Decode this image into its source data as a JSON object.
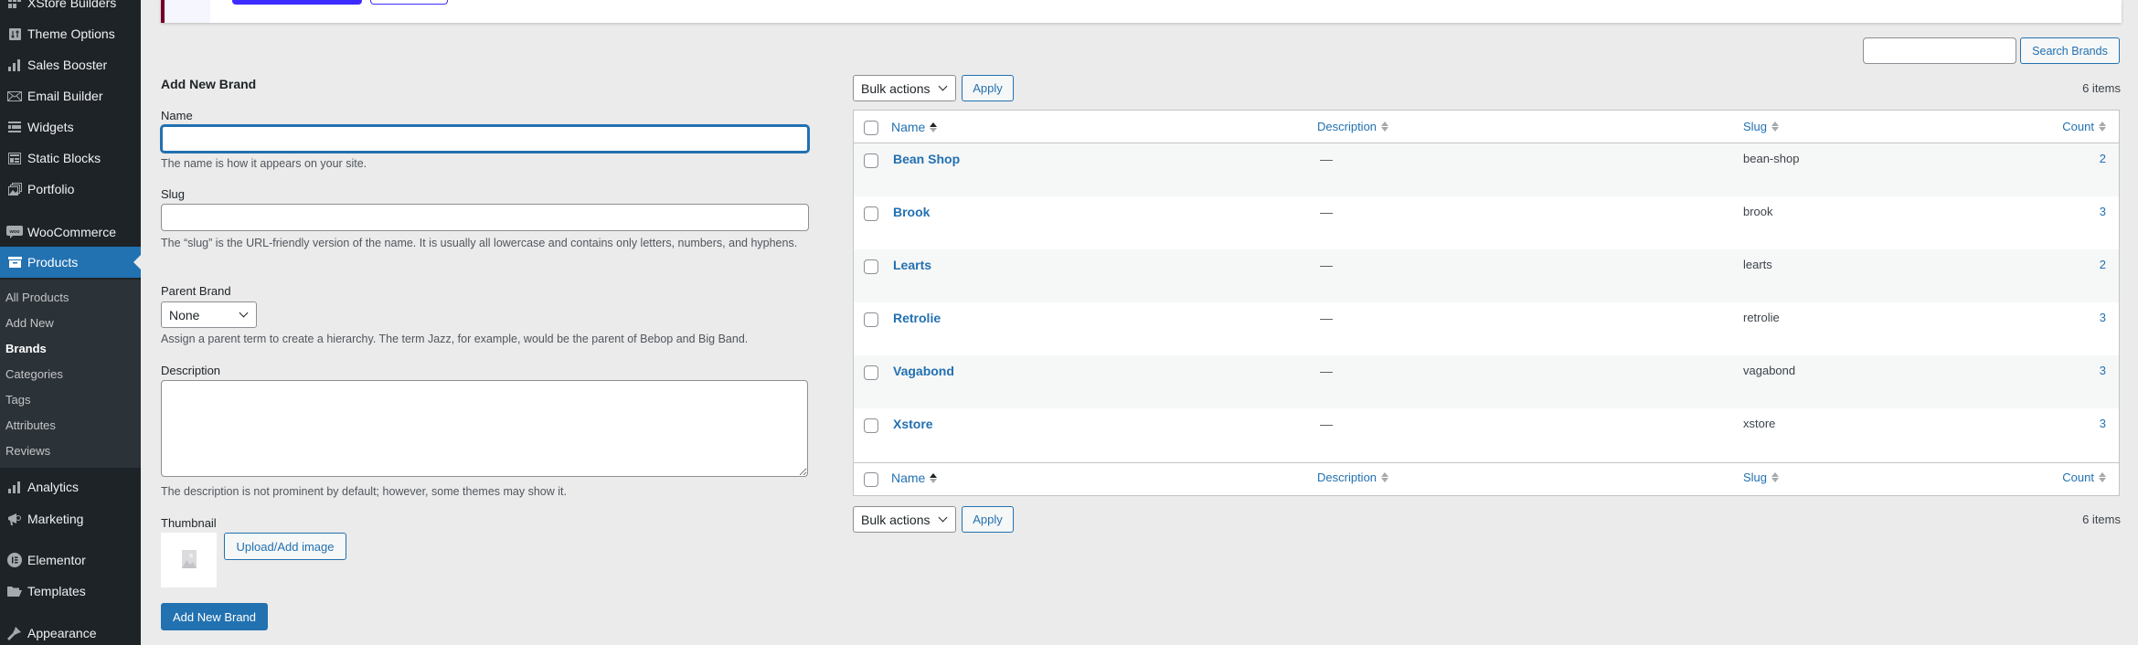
{
  "sidebar": {
    "items": [
      {
        "label": "XStore Builders",
        "icon": "grid-icon"
      },
      {
        "label": "Theme Options",
        "icon": "settings-icon"
      },
      {
        "label": "Sales Booster",
        "icon": "bar-chart-icon"
      },
      {
        "label": "Email Builder",
        "icon": "envelope-icon"
      },
      {
        "label": "Widgets",
        "icon": "widgets-icon"
      },
      {
        "label": "Static Blocks",
        "icon": "blocks-icon"
      },
      {
        "label": "Portfolio",
        "icon": "portfolio-icon"
      },
      {
        "label": "WooCommerce",
        "icon": "woo-icon"
      },
      {
        "label": "Products",
        "icon": "archive-icon"
      },
      {
        "label": "Analytics",
        "icon": "bar-chart-icon"
      },
      {
        "label": "Marketing",
        "icon": "megaphone-icon"
      },
      {
        "label": "Elementor",
        "icon": "elementor-icon"
      },
      {
        "label": "Templates",
        "icon": "folder-icon"
      },
      {
        "label": "Appearance",
        "icon": "brush-icon"
      }
    ],
    "submenu": [
      "All Products",
      "Add New",
      "Brands",
      "Categories",
      "Tags",
      "Attributes",
      "Reviews"
    ],
    "current_submenu": "Brands"
  },
  "form": {
    "title": "Add New Brand",
    "name_label": "Name",
    "name_value": "",
    "name_help": "The name is how it appears on your site.",
    "slug_label": "Slug",
    "slug_value": "",
    "slug_help": "The “slug” is the URL-friendly version of the name. It is usually all lowercase and contains only letters, numbers, and hyphens.",
    "parent_label": "Parent Brand",
    "parent_value": "None",
    "parent_help": "Assign a parent term to create a hierarchy. The term Jazz, for example, would be the parent of Bebop and Big Band.",
    "description_label": "Description",
    "description_value": "",
    "description_help": "The description is not prominent by default; however, some themes may show it.",
    "thumbnail_label": "Thumbnail",
    "upload_button": "Upload/Add image",
    "submit_button": "Add New Brand"
  },
  "list": {
    "search_placeholder": "",
    "search_button": "Search Brands",
    "bulk_actions": "Bulk actions",
    "apply": "Apply",
    "items_count": "6 items",
    "columns": {
      "name": "Name",
      "description": "Description",
      "slug": "Slug",
      "count": "Count"
    },
    "rows": [
      {
        "name": "Bean Shop",
        "description": "—",
        "slug": "bean-shop",
        "count": "2"
      },
      {
        "name": "Brook",
        "description": "—",
        "slug": "brook",
        "count": "3"
      },
      {
        "name": "Learts",
        "description": "—",
        "slug": "learts",
        "count": "2"
      },
      {
        "name": "Retrolie",
        "description": "—",
        "slug": "retrolie",
        "count": "3"
      },
      {
        "name": "Vagabond",
        "description": "—",
        "slug": "vagabond",
        "count": "3"
      },
      {
        "name": "Xstore",
        "description": "—",
        "slug": "xstore",
        "count": "3"
      }
    ]
  },
  "colors": {
    "accent": "#2271b1",
    "sidebar_bg": "#1d2327",
    "banner_accent": "#3c2cff"
  }
}
